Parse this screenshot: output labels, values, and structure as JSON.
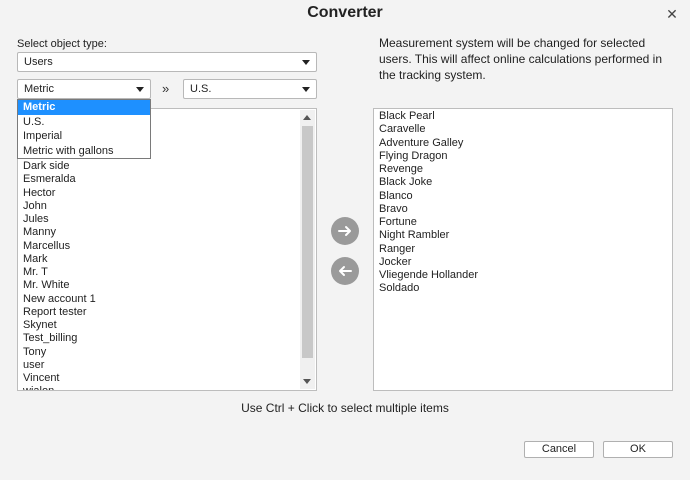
{
  "window": {
    "title": "Converter"
  },
  "form": {
    "object_type_label": "Select object type:",
    "object_type_value": "Users",
    "from_value": "Metric",
    "to_value": "U.S.",
    "convert_symbol": "»"
  },
  "info_text": "Measurement system will be changed for selected users. This will affect online calculations performed in the tracking system.",
  "dropdown": {
    "options": [
      "Metric",
      "U.S.",
      "Imperial",
      "Metric with gallons"
    ],
    "selected": "Metric"
  },
  "left_list": {
    "items": [
      "Dark side",
      "Esmeralda",
      "Hector",
      "John",
      "Jules",
      "Manny",
      "Marcellus",
      "Mark",
      "Mr. T",
      "Mr. White",
      "New account 1",
      "Report tester",
      "Skynet",
      "Test_billing",
      "Tony",
      "user",
      "Vincent",
      "wialon"
    ]
  },
  "right_list": {
    "items": [
      "Black Pearl",
      "Caravelle",
      "Adventure Galley",
      "Flying Dragon",
      "Revenge",
      "Black Joke",
      "Blanco",
      "Bravo",
      "Fortune",
      "Night Rambler",
      "Ranger",
      "Jocker",
      "Vliegende Hollander",
      "Soldado"
    ]
  },
  "hint": "Use Ctrl + Click to select multiple items",
  "buttons": {
    "cancel": "Cancel",
    "ok": "OK"
  },
  "icons": {
    "close": "close-icon",
    "move_right": "arrow-right-icon",
    "move_left": "arrow-left-icon"
  },
  "colors": {
    "accent": "#1e90ff",
    "round_button": "#9a9a9a"
  }
}
